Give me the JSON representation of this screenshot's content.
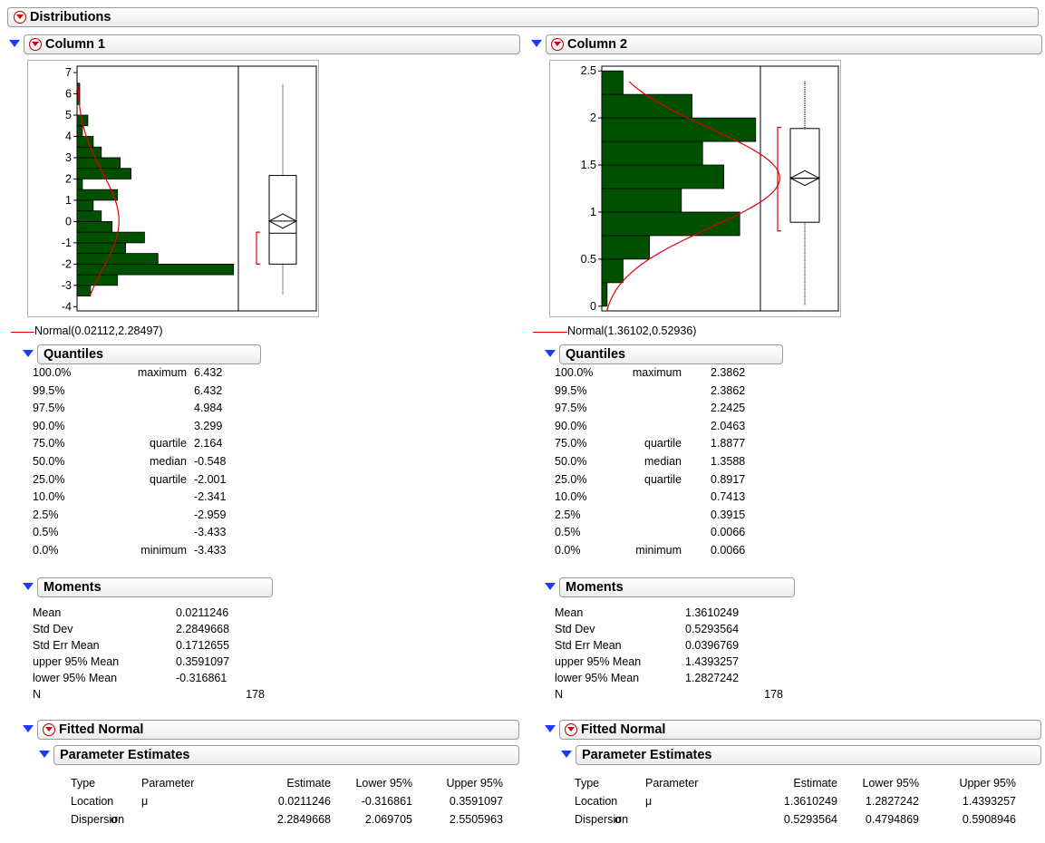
{
  "top": {
    "title": "Distributions"
  },
  "columns": [
    {
      "title": "Column 1",
      "normal_label": "Normal(0.02112,2.28497)",
      "quantiles": {
        "title": "Quantiles",
        "rows": [
          [
            "100.0%",
            "maximum",
            "6.432"
          ],
          [
            "99.5%",
            "",
            "6.432"
          ],
          [
            "97.5%",
            "",
            "4.984"
          ],
          [
            "90.0%",
            "",
            "3.299"
          ],
          [
            "75.0%",
            "quartile",
            "2.164"
          ],
          [
            "50.0%",
            "median",
            "-0.548"
          ],
          [
            "25.0%",
            "quartile",
            "-2.001"
          ],
          [
            "10.0%",
            "",
            "-2.341"
          ],
          [
            "2.5%",
            "",
            "-2.959"
          ],
          [
            "0.5%",
            "",
            "-3.433"
          ],
          [
            "0.0%",
            "minimum",
            "-3.433"
          ]
        ]
      },
      "moments": {
        "title": "Moments",
        "rows": [
          [
            "Mean",
            "0.0211246"
          ],
          [
            "Std Dev",
            "2.2849668"
          ],
          [
            "Std Err Mean",
            "0.1712655"
          ],
          [
            "upper 95% Mean",
            "0.3591097"
          ],
          [
            "lower 95% Mean",
            "-0.316861"
          ],
          [
            "N",
            "178"
          ]
        ]
      },
      "fitted": {
        "title": "Fitted Normal"
      },
      "params": {
        "title": "Parameter Estimates",
        "headers": [
          "Type",
          "Parameter",
          "Estimate",
          "Lower 95%",
          "Upper 95%"
        ],
        "rows": [
          [
            "Location",
            "μ",
            "0.0211246",
            "-0.316861",
            "0.3591097"
          ],
          [
            "Dispersion",
            "σ",
            "2.2849668",
            "2.069705",
            "2.5505963"
          ]
        ]
      }
    },
    {
      "title": "Column 2",
      "normal_label": "Normal(1.36102,0.52936)",
      "quantiles": {
        "title": "Quantiles",
        "rows": [
          [
            "100.0%",
            "maximum",
            "2.3862"
          ],
          [
            "99.5%",
            "",
            "2.3862"
          ],
          [
            "97.5%",
            "",
            "2.2425"
          ],
          [
            "90.0%",
            "",
            "2.0463"
          ],
          [
            "75.0%",
            "quartile",
            "1.8877"
          ],
          [
            "50.0%",
            "median",
            "1.3588"
          ],
          [
            "25.0%",
            "quartile",
            "0.8917"
          ],
          [
            "10.0%",
            "",
            "0.7413"
          ],
          [
            "2.5%",
            "",
            "0.3915"
          ],
          [
            "0.5%",
            "",
            "0.0066"
          ],
          [
            "0.0%",
            "minimum",
            "0.0066"
          ]
        ]
      },
      "moments": {
        "title": "Moments",
        "rows": [
          [
            "Mean",
            "1.3610249"
          ],
          [
            "Std Dev",
            "0.5293564"
          ],
          [
            "Std Err Mean",
            "0.0396769"
          ],
          [
            "upper 95% Mean",
            "1.4393257"
          ],
          [
            "lower 95% Mean",
            "1.2827242"
          ],
          [
            "N",
            "178"
          ]
        ]
      },
      "fitted": {
        "title": "Fitted Normal"
      },
      "params": {
        "title": "Parameter Estimates",
        "headers": [
          "Type",
          "Parameter",
          "Estimate",
          "Lower 95%",
          "Upper 95%"
        ],
        "rows": [
          [
            "Location",
            "μ",
            "1.3610249",
            "1.2827242",
            "1.4393257"
          ],
          [
            "Dispersion",
            "σ",
            "0.5293564",
            "0.4794869",
            "0.5908946"
          ]
        ]
      }
    }
  ],
  "chart_data": [
    {
      "type": "bar",
      "orientation": "horizontal",
      "bin_width": 0.5,
      "bins_from": [
        -3.5,
        -3.0,
        -2.5,
        -2.0,
        -1.5,
        -1.0,
        -0.5,
        0.0,
        0.5,
        1.0,
        1.5,
        2.0,
        2.5,
        3.0,
        3.5,
        4.0,
        4.5,
        5.0,
        5.5,
        6.0
      ],
      "values": [
        5,
        15,
        58,
        30,
        18,
        25,
        13,
        9,
        6,
        15,
        2,
        20,
        16,
        9,
        6,
        2,
        4,
        0,
        1,
        1
      ],
      "ylim": [
        -4.2,
        7.3
      ],
      "ytick_labels": [
        "-4",
        "-3",
        "-2",
        "-1",
        "0",
        "1",
        "2",
        "3",
        "4",
        "5",
        "6",
        "7"
      ],
      "normal_fit": {
        "mean": 0.02112,
        "sd": 2.28497
      },
      "boxplot": {
        "min": -3.433,
        "q1": -2.001,
        "median": -0.548,
        "q3": 2.164,
        "max": 6.432,
        "mean": 0.0211246,
        "mean_ci": [
          -0.316861,
          0.3591097
        ],
        "shortest_half": [
          -2.0,
          -0.5
        ]
      },
      "colors": {
        "bar": "#005000",
        "curve": "#e00000"
      }
    },
    {
      "type": "bar",
      "orientation": "horizontal",
      "bin_width": 0.25,
      "bins_from": [
        0.0,
        0.25,
        0.5,
        0.75,
        1.0,
        1.25,
        1.5,
        1.75,
        2.0,
        2.25
      ],
      "values": [
        1,
        4,
        9,
        26,
        15,
        23,
        19,
        29,
        17,
        4
      ],
      "ylim": [
        -0.05,
        2.55
      ],
      "ytick_labels": [
        "0",
        "0.5",
        "1",
        "1.5",
        "2",
        "2.5"
      ],
      "normal_fit": {
        "mean": 1.36102,
        "sd": 0.52936
      },
      "boxplot": {
        "min": 0.0066,
        "q1": 0.8917,
        "median": 1.3588,
        "q3": 1.8877,
        "max": 2.3862,
        "mean": 1.3610249,
        "mean_ci": [
          1.2827242,
          1.4393257
        ],
        "shortest_half": [
          0.8,
          1.9
        ]
      },
      "colors": {
        "bar": "#005000",
        "curve": "#e00000"
      }
    }
  ]
}
